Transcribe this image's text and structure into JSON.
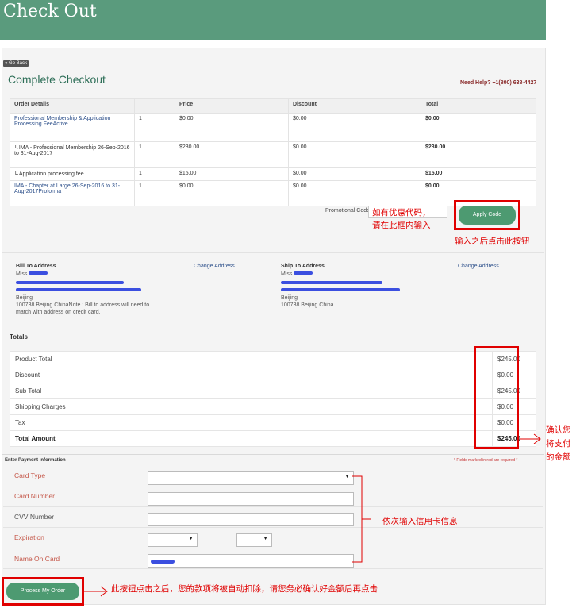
{
  "header": {
    "title": "Check Out"
  },
  "nav": {
    "go_back": "« Go Back"
  },
  "page": {
    "title": "Complete Checkout",
    "help": "Need Help? +1(800) 638-4427"
  },
  "order": {
    "columns": [
      "Order Details",
      "",
      "Price",
      "Discount",
      "Total"
    ],
    "rows": [
      {
        "item": "Professional Membership & Application Processing FeeActive",
        "qty": "1",
        "price": "$0.00",
        "discount": "$0.00",
        "total": "$0.00"
      },
      {
        "item": "↳IMA - Professional Membership 26-Sep-2016 to 31-Aug-2017",
        "qty": "1",
        "price": "$230.00",
        "discount": "$0.00",
        "total": "$230.00"
      },
      {
        "item": "↳Application processing fee",
        "qty": "1",
        "price": "$15.00",
        "discount": "$0.00",
        "total": "$15.00"
      },
      {
        "item": "IMA - Chapter at Large 26-Sep-2016 to 31-Aug-2017Proforma",
        "qty": "1",
        "price": "$0.00",
        "discount": "$0.00",
        "total": "$0.00"
      }
    ]
  },
  "promo": {
    "label": "Promotional Code",
    "note_line1": "如有优惠代码，",
    "note_line2": "请在此框内输入",
    "apply_label": "Apply Code",
    "apply_note": "输入之后点击此按钮"
  },
  "bill": {
    "title": "Bill To Address",
    "salutation": "Miss",
    "city": "Beijing",
    "detail_line1": "100738 Beijing ChinaNote : Bill to address will need to",
    "detail_line2": "match with address on credit card.",
    "change": "Change Address"
  },
  "ship": {
    "title": "Ship To Address",
    "salutation": "Miss",
    "city": "Beijing",
    "detail_line1": "100738 Beijing China",
    "change": "Change Address"
  },
  "totals": {
    "title": "Totals",
    "rows": [
      {
        "label": "Product Total",
        "value": "$245.00"
      },
      {
        "label": "Discount",
        "value": "$0.00"
      },
      {
        "label": "Sub Total",
        "value": "$245.00"
      },
      {
        "label": "Shipping Charges",
        "value": "$0.00"
      },
      {
        "label": "Tax",
        "value": "$0.00"
      },
      {
        "label": "Total Amount",
        "value": "$245.00"
      }
    ],
    "confirm_note": "确认您将支付的金额"
  },
  "payment": {
    "title": "Enter Payment Information",
    "required_note": "* Fields marked in red are required *",
    "card_type": "Card Type",
    "card_number": "Card Number",
    "cvv": "CVV Number",
    "expiration": "Expiration",
    "name_on_card": "Name On Card",
    "card_note": "依次输入信用卡信息"
  },
  "process": {
    "label": "Process My Order",
    "note": "此按钮点击之后，您的款项将被自动扣除，请您务必确认好金额后再点击"
  },
  "colors": {
    "header": "#5a9b7d",
    "button": "#4d9a71",
    "annotation": "#e00000",
    "redacted": "#3b4fe0"
  }
}
